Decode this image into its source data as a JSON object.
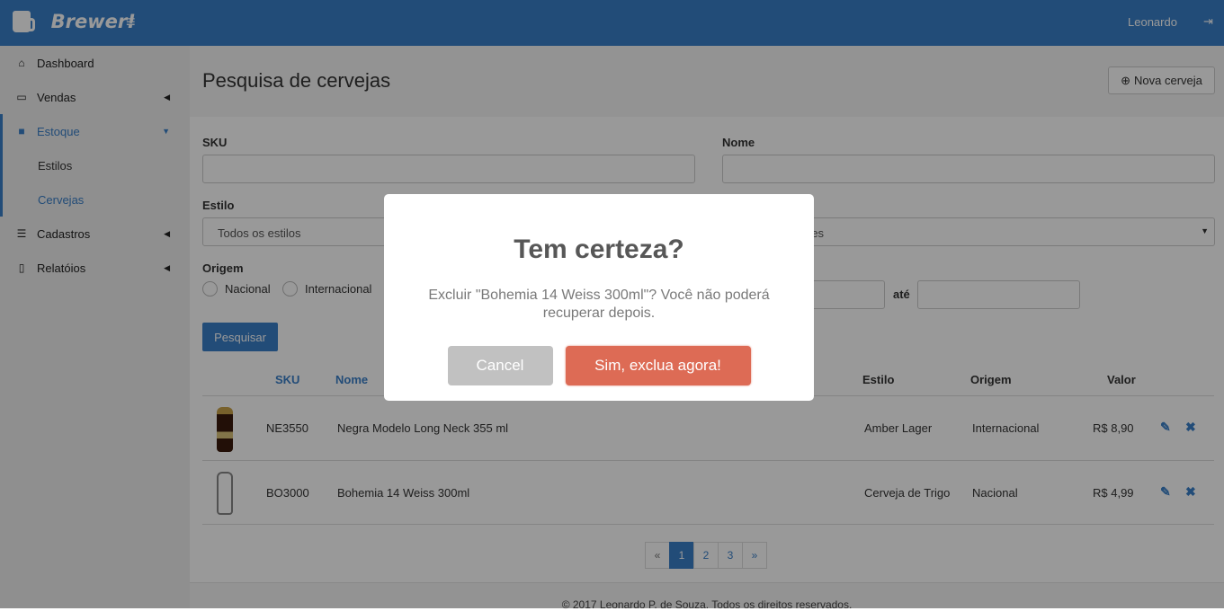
{
  "header": {
    "brand": "Brewer!",
    "user": "Leonardo"
  },
  "sidebar": {
    "items": [
      {
        "label": "Dashboard",
        "icon": "home-icon"
      },
      {
        "label": "Vendas",
        "icon": "credit-card-icon"
      },
      {
        "label": "Estoque",
        "icon": "truck-icon"
      },
      {
        "label": "Cadastros",
        "icon": "database-icon"
      },
      {
        "label": "Relatóios",
        "icon": "file-pdf-icon"
      }
    ],
    "subitems": [
      {
        "label": "Estilos"
      },
      {
        "label": "Cervejas"
      }
    ]
  },
  "page": {
    "title": "Pesquisa de cervejas",
    "new_button": "Nova cerveja"
  },
  "filters": {
    "sku_label": "SKU",
    "nome_label": "Nome",
    "estilo_label": "Estilo",
    "estilo_value": "Todos os estilos",
    "sabor_value_visible": "res",
    "origem_label": "Origem",
    "origem_options": [
      "Nacional",
      "Internacional"
    ],
    "ate_label": "até",
    "search_button": "Pesquisar"
  },
  "table": {
    "headers": [
      "SKU",
      "Nome",
      "Estilo",
      "Origem",
      "Valor"
    ],
    "rows": [
      {
        "sku": "NE3550",
        "nome": "Negra Modelo Long Neck 355 ml",
        "estilo": "Amber Lager",
        "origem": "Internacional",
        "valor": "R$ 8,90"
      },
      {
        "sku": "BO3000",
        "nome": "Bohemia 14 Weiss 300ml",
        "estilo": "Cerveja de Trigo",
        "origem": "Nacional",
        "valor": "R$ 4,99"
      }
    ]
  },
  "pagination": {
    "prev": "«",
    "pages": [
      "1",
      "2",
      "3"
    ],
    "current": "1",
    "next": "»"
  },
  "footer": "© 2017 Leonardo P. de Souza. Todos os direitos reservados.",
  "modal": {
    "title": "Tem certeza?",
    "text": "Excluir \"Bohemia 14 Weiss 300ml\"? Você não poderá recuperar depois.",
    "cancel": "Cancel",
    "confirm": "Sim, exclua agora!"
  },
  "colors": {
    "primary": "#3a7fc8",
    "confirm": "#dd6b55",
    "cancel": "#c1c1c1"
  }
}
